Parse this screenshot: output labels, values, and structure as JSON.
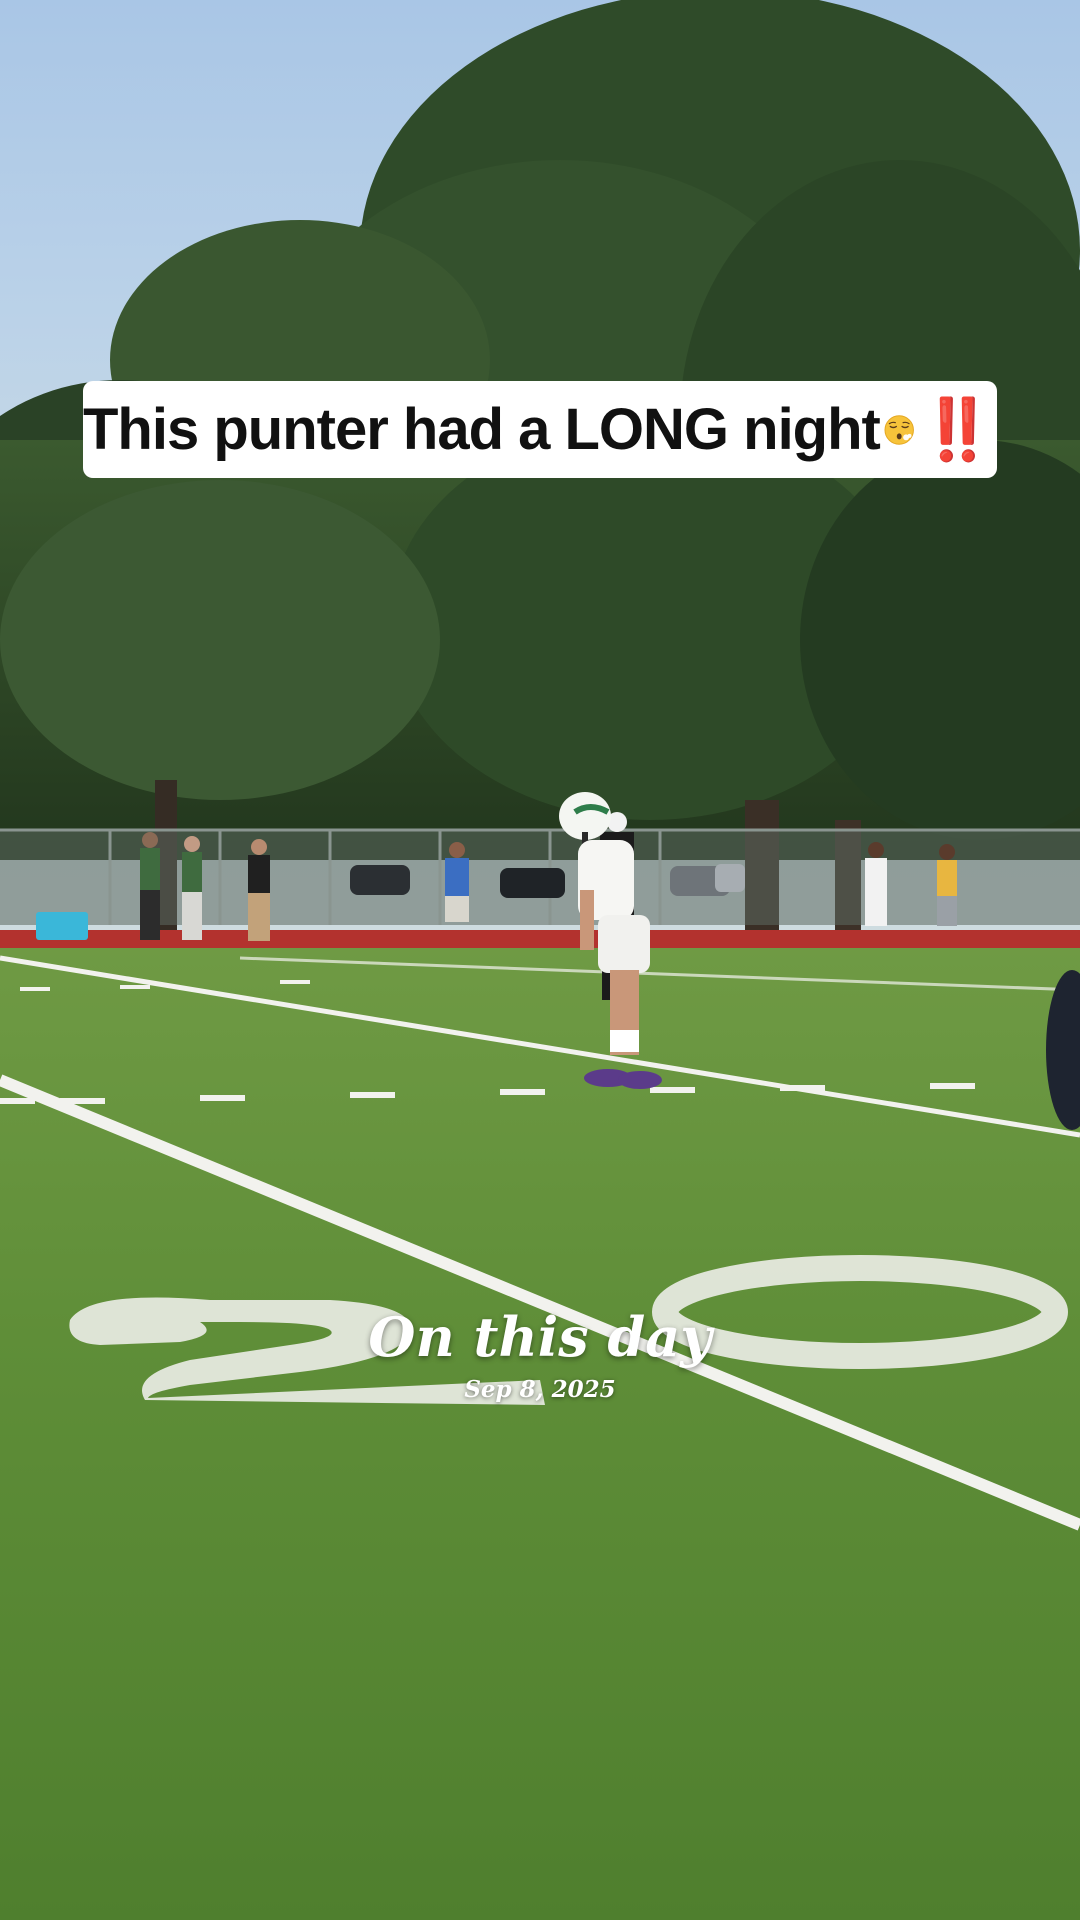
{
  "caption": {
    "text": "This punter had a LONG night",
    "emoji": "face-exhaling-emoji",
    "exclamation": "‼️"
  },
  "memory": {
    "title": "On this day",
    "date": "Sep 8, 2025"
  },
  "scene": {
    "field_number": "20",
    "colors": {
      "turf": "#5f8f3a",
      "track": "#b3322e",
      "sky": "#b9d1e8",
      "trees": "#2f4a2a"
    }
  }
}
